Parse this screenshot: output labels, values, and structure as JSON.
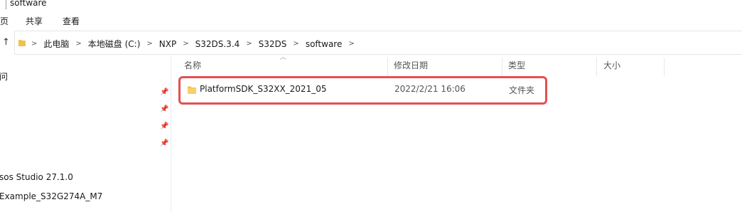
{
  "window": {
    "title": "software"
  },
  "ribbon": {
    "tabs": [
      "页",
      "共享",
      "查看"
    ]
  },
  "address": {
    "separator": ">",
    "crumbs": [
      "此电脑",
      "本地磁盘 (C:)",
      "NXP",
      "S32DS.3.4",
      "S32DS",
      "software"
    ]
  },
  "nav_pane": {
    "top_label": "问",
    "items": [
      "sos Studio 27.1.0",
      "Example_S32G274A_M7"
    ]
  },
  "columns": {
    "name": "名称",
    "modified": "修改日期",
    "type": "类型",
    "size": "大小"
  },
  "files": [
    {
      "name": "PlatformSDK_S32XX_2021_05",
      "modified": "2022/2/21 16:06",
      "type": "文件夹",
      "size": ""
    }
  ],
  "colors": {
    "folder": "#f1c24b",
    "highlight": "#e35050"
  }
}
